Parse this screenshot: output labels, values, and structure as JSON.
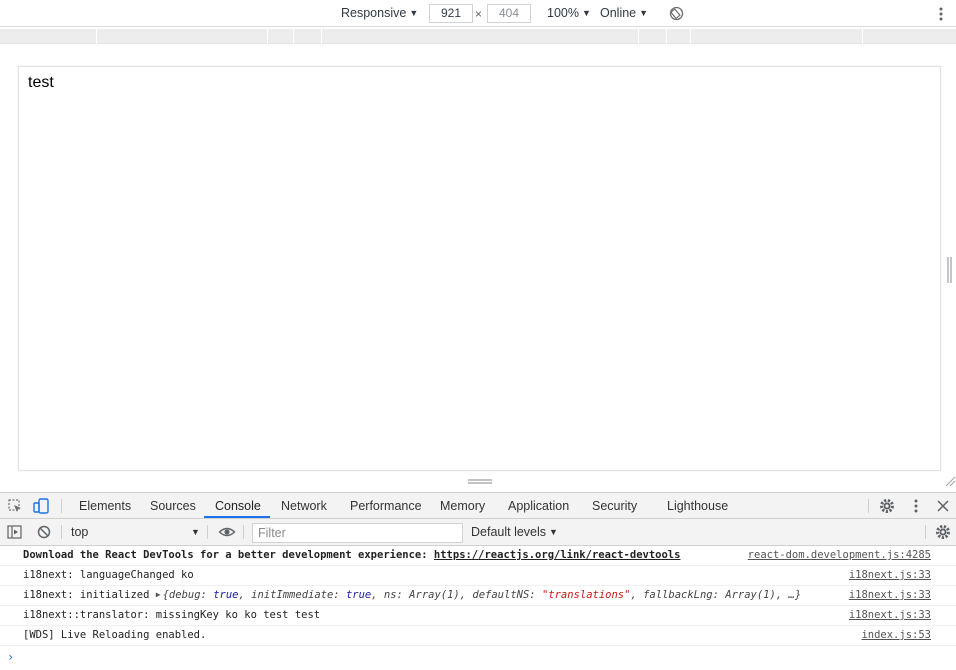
{
  "device_toolbar": {
    "device": "Responsive",
    "width": "921",
    "height": "404",
    "times": "×",
    "zoom": "100%",
    "throttle": "Online",
    "caret": "▼"
  },
  "viewport": {
    "page_text": "test"
  },
  "devtools_tabs": {
    "items": [
      "Elements",
      "Sources",
      "Console",
      "Network",
      "Performance",
      "Memory",
      "Application",
      "Security",
      "Lighthouse"
    ],
    "active": "Console"
  },
  "console_toolbar": {
    "context": "top",
    "filter_placeholder": "Filter",
    "levels": "Default levels"
  },
  "messages": [
    {
      "prefix": "Download the React DevTools for a better development experience: ",
      "link": "https://reactjs.org/link/react-devtools",
      "source": "react-dom.development.js:4285"
    },
    {
      "text": "i18next: languageChanged ko",
      "source": "i18next.js:33"
    },
    {
      "text": "i18next: initialized ",
      "obj_open": "{",
      "k1": "debug: ",
      "v1": "true",
      "k2": ", initImmediate: ",
      "v2": "true",
      "k3": ", ns: Array(1), defaultNS: ",
      "v3": "\"translations\"",
      "k4": ", fallbackLng: Array(1), …}",
      "source": "i18next.js:33"
    },
    {
      "text": "i18next::translator: missingKey ko ko test test",
      "source": "i18next.js:33"
    },
    {
      "text": "[WDS] Live Reloading enabled.",
      "source": "index.js:53"
    }
  ],
  "colors": {
    "accent": "#1a73e8",
    "string": "#c41a16",
    "boolean": "#1a1aa6"
  }
}
